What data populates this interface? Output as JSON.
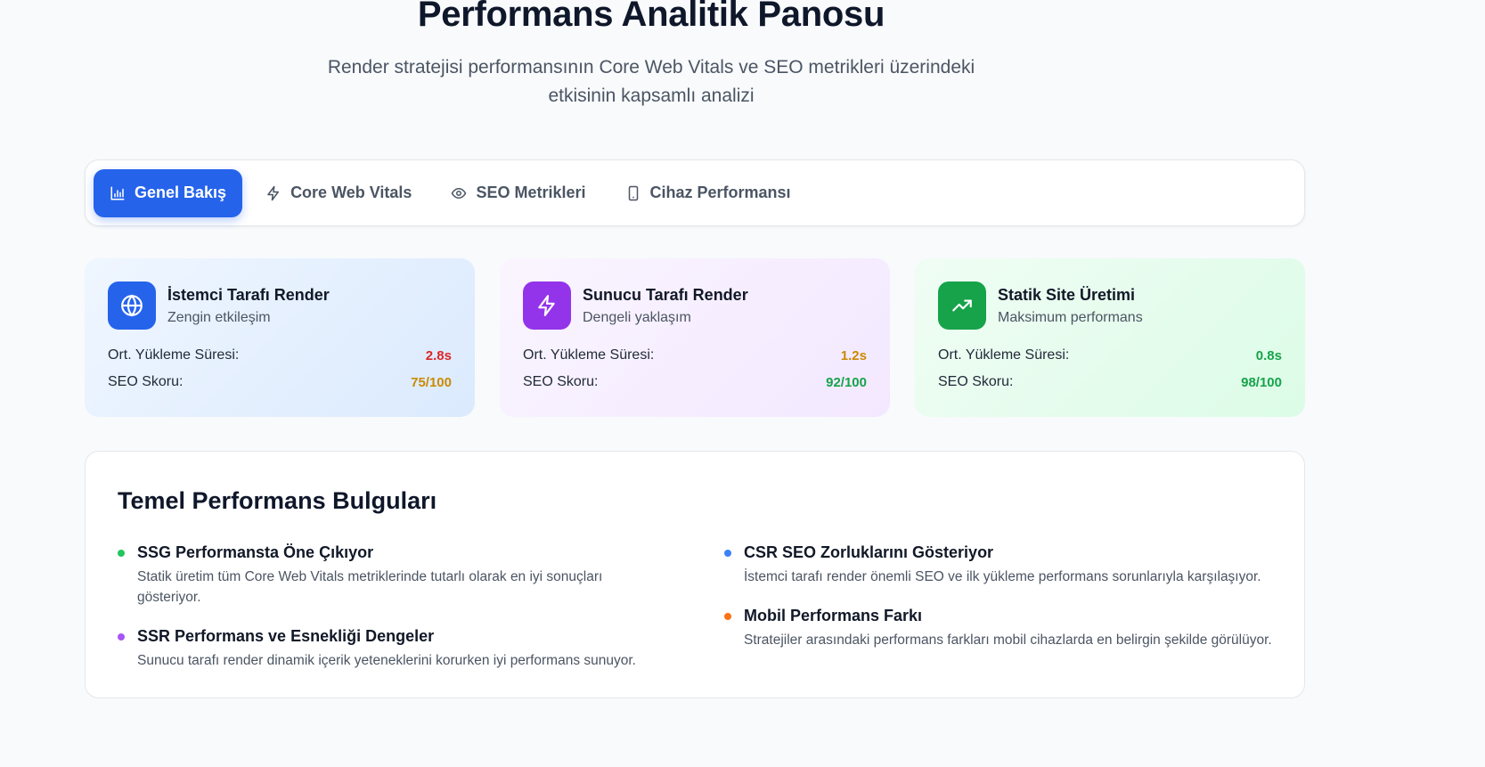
{
  "header": {
    "title": "Performans Analitik Panosu",
    "subtitle": "Render stratejisi performansının Core Web Vitals ve SEO metrikleri üzerindeki etkisinin kapsamlı analizi"
  },
  "tabs": [
    {
      "label": "Genel Bakış",
      "icon": "bar-chart-icon",
      "active": true
    },
    {
      "label": "Core Web Vitals",
      "icon": "lightning-icon",
      "active": false
    },
    {
      "label": "SEO Metrikleri",
      "icon": "eye-icon",
      "active": false
    },
    {
      "label": "Cihaz Performansı",
      "icon": "smartphone-icon",
      "active": false
    }
  ],
  "cards": [
    {
      "title": "İstemci Tarafı Render",
      "desc": "Zengin etkileşim",
      "icon": "globe-icon",
      "load_label": "Ort. Yükleme Süresi:",
      "load_value": "2.8s",
      "seo_label": "SEO Skoru:",
      "seo_value": "75/100"
    },
    {
      "title": "Sunucu Tarafı Render",
      "desc": "Dengeli yaklaşım",
      "icon": "lightning-icon",
      "load_label": "Ort. Yükleme Süresi:",
      "load_value": "1.2s",
      "seo_label": "SEO Skoru:",
      "seo_value": "92/100"
    },
    {
      "title": "Statik Site Üretimi",
      "desc": "Maksimum performans",
      "icon": "trending-up-icon",
      "load_label": "Ort. Yükleme Süresi:",
      "load_value": "0.8s",
      "seo_label": "SEO Skoru:",
      "seo_value": "98/100"
    }
  ],
  "findings": {
    "title": "Temel Performans Bulguları",
    "items": [
      {
        "title": "SSG Performansta Öne Çıkıyor",
        "desc": "Statik üretim tüm Core Web Vitals metriklerinde tutarlı olarak en iyi sonuçları gösteriyor.",
        "color": "#22c55e"
      },
      {
        "title": "SSR Performans ve Esnekliği Dengeler",
        "desc": "Sunucu tarafı render dinamik içerik yeteneklerini korurken iyi performans sunuyor.",
        "color": "#a855f7"
      },
      {
        "title": "CSR SEO Zorluklarını Gösteriyor",
        "desc": "İstemci tarafı render önemli SEO ve ilk yükleme performans sorunlarıyla karşılaşıyor.",
        "color": "#3b82f6"
      },
      {
        "title": "Mobil Performans Farkı",
        "desc": "Stratejiler arasındaki performans farkları mobil cihazlarda en belirgin şekilde görülüyor.",
        "color": "#f97316"
      }
    ]
  }
}
